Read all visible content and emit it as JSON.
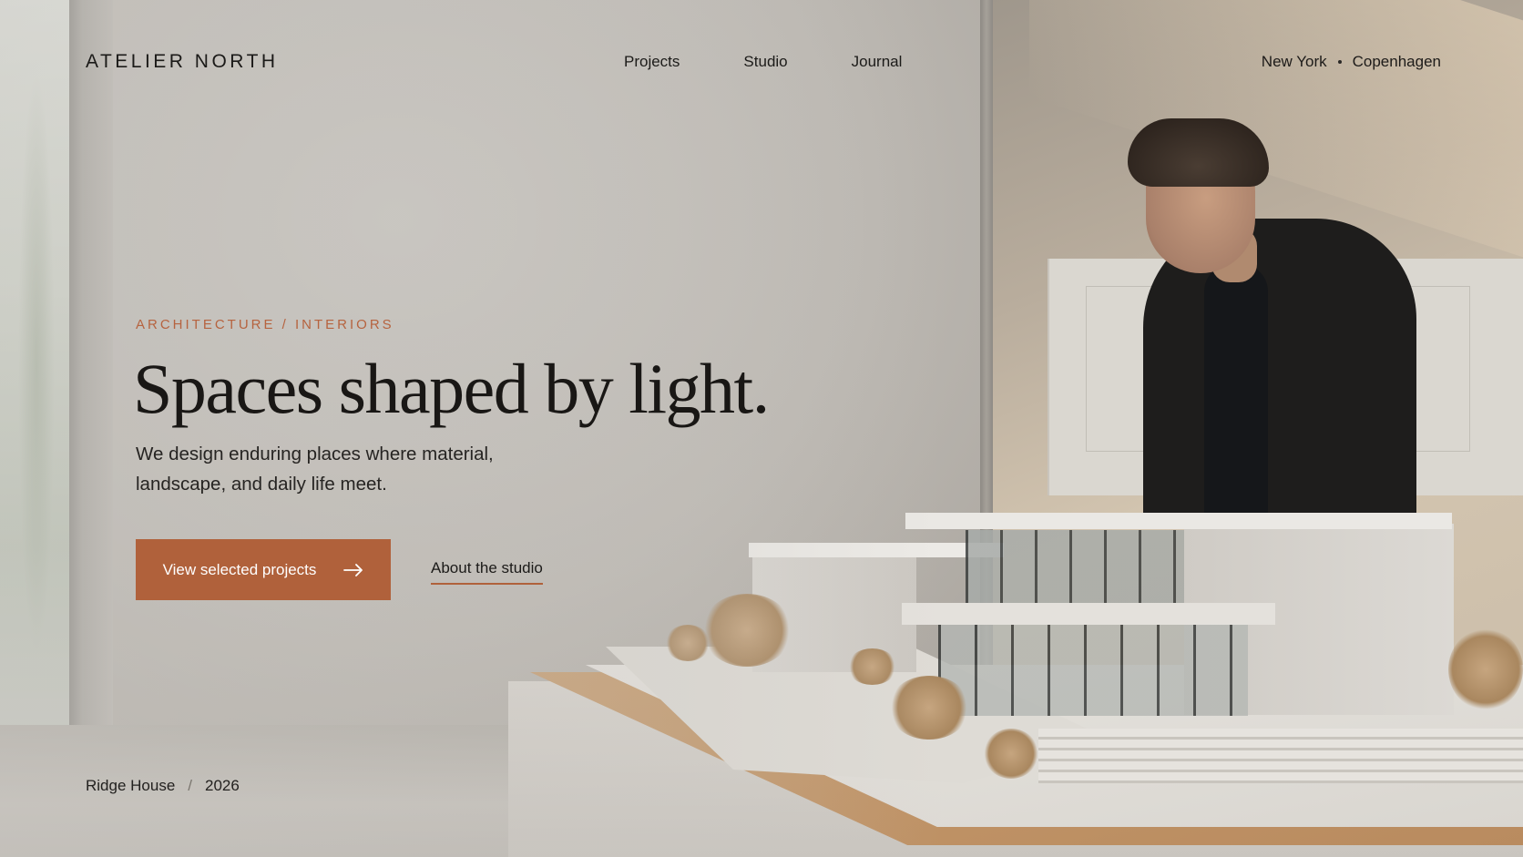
{
  "brand": {
    "name": "ATELIER NORTH"
  },
  "nav": {
    "items": [
      "Projects",
      "Studio",
      "Journal"
    ]
  },
  "locations": {
    "first": "New York",
    "second": "Copenhagen"
  },
  "hero": {
    "eyebrow": "ARCHITECTURE / INTERIORS",
    "headline": "Spaces shaped by light.",
    "subcopy": "We design enduring places where material, landscape, and daily life meet.",
    "primary_cta": "View selected projects",
    "secondary_cta": "About the studio"
  },
  "caption": {
    "project": "Ridge House",
    "separator": "/",
    "year": "2026"
  },
  "colors": {
    "accent": "#b0613b",
    "text": "#1d1b19",
    "wall": "#c2beb8"
  },
  "icons": {
    "cta_icon": "arrow-right-icon"
  }
}
